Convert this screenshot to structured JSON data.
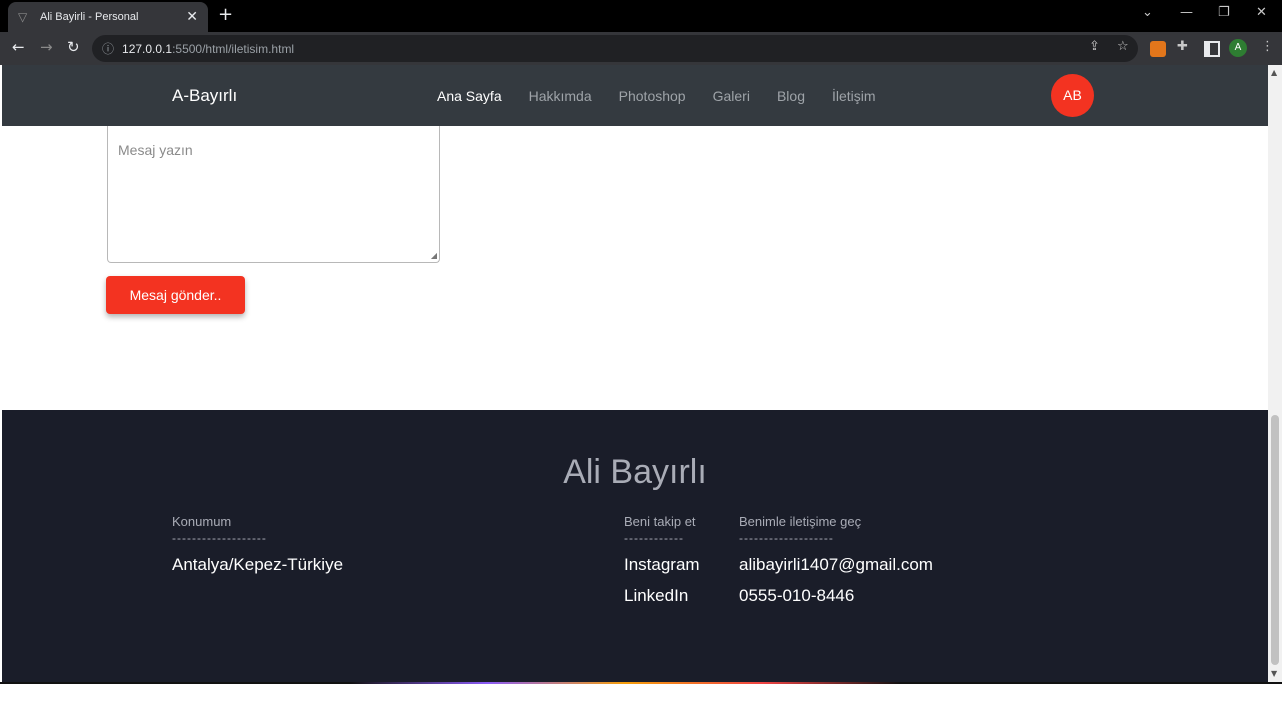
{
  "browser": {
    "tab_title": "Ali Bayirli - Personal",
    "url_host": "127.0.0.1",
    "url_path": ":5500/html/iletisim.html",
    "profile_initial": "A"
  },
  "site": {
    "brand": "A-Bayırlı",
    "nav": [
      "Ana Sayfa",
      "Hakkımda",
      "Photoshop",
      "Galeri",
      "Blog",
      "İletişim"
    ],
    "avatar": "AB",
    "accent": "#f33321"
  },
  "form": {
    "message_placeholder": "Mesaj yazın",
    "send_label": "Mesaj gönder.."
  },
  "footer": {
    "title": "Ali Bayırlı",
    "location": {
      "heading": "Konumum",
      "divider": "-------------------",
      "items": [
        "Antalya/Kepez-Türkiye"
      ]
    },
    "follow": {
      "heading": "Beni takip et",
      "divider": "------------",
      "items": [
        "Instagram",
        "LinkedIn"
      ]
    },
    "contact": {
      "heading": "Benimle iletişime geç",
      "divider": "-------------------",
      "items": [
        "alibayirli1407@gmail.com",
        "0555-010-8446"
      ]
    }
  }
}
